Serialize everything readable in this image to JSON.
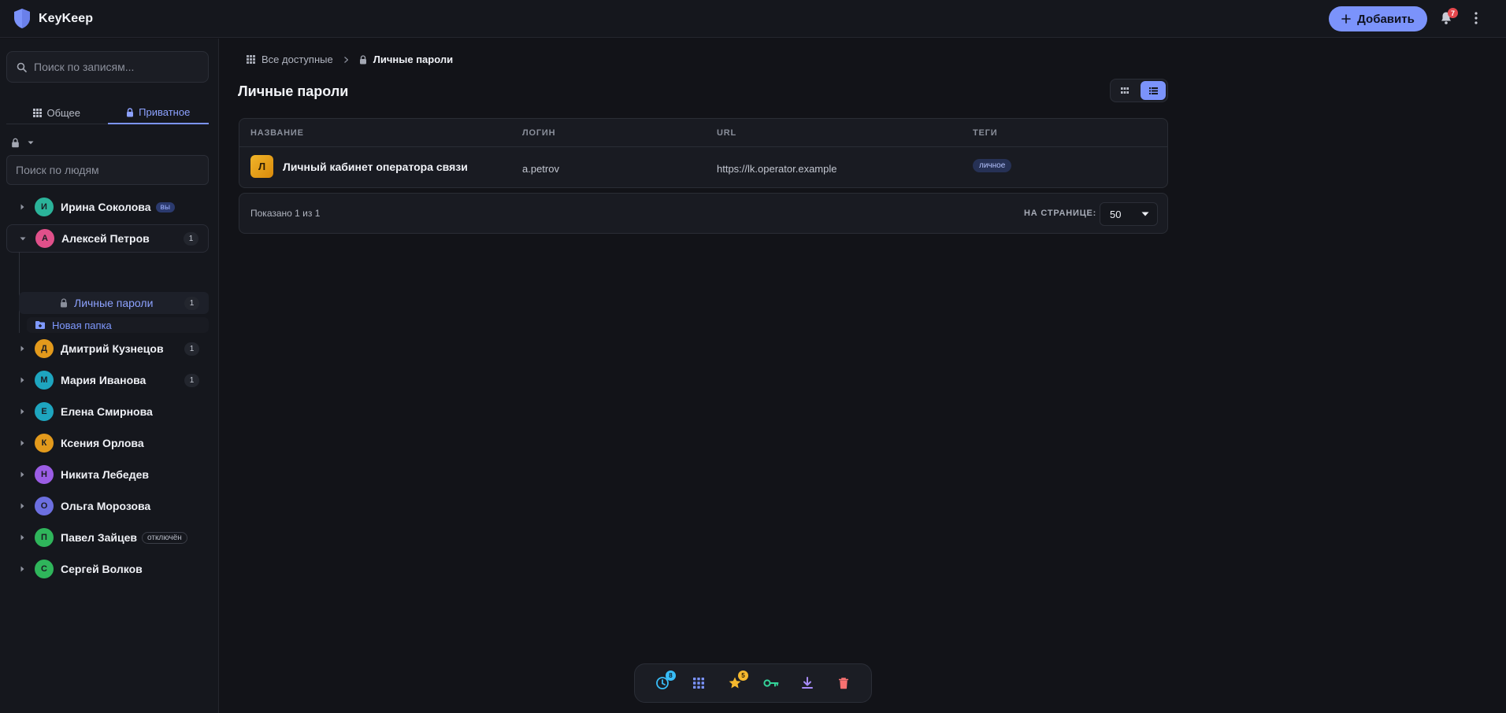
{
  "app": {
    "name": "KeyKeep",
    "add_label": "Добавить",
    "notifications_count": "7"
  },
  "sidebar": {
    "search_placeholder": "Поиск по записям...",
    "tabs": [
      {
        "label": "Общее",
        "icon": "grid-icon",
        "active": false
      },
      {
        "label": "Приватное",
        "icon": "lock-icon",
        "active": true
      }
    ],
    "people_search_placeholder": "Поиск по людям",
    "people": [
      {
        "initial": "И",
        "name": "Ирина Соколова",
        "badge": "вы",
        "count": "",
        "color": "#2bb39a"
      },
      {
        "initial": "А",
        "name": "Алексей Петров",
        "badge": "",
        "count": "1",
        "color": "#e0508a",
        "expanded": true
      },
      {
        "initial": "Д",
        "name": "Дмитрий Кузнецов",
        "badge": "",
        "count": "1",
        "color": "#e39a1c"
      },
      {
        "initial": "М",
        "name": "Мария Иванова",
        "badge": "",
        "count": "1",
        "color": "#1ea5bf"
      },
      {
        "initial": "Е",
        "name": "Елена Смирнова",
        "badge": "",
        "count": "",
        "color": "#1ea5bf"
      },
      {
        "initial": "К",
        "name": "Ксения Орлова",
        "badge": "",
        "count": "",
        "color": "#e39a1c"
      },
      {
        "initial": "Н",
        "name": "Никита Лебедев",
        "badge": "",
        "count": "",
        "color": "#9b5de5"
      },
      {
        "initial": "О",
        "name": "Ольга Морозова",
        "badge": "",
        "count": "",
        "color": "#6c6fe0"
      },
      {
        "initial": "П",
        "name": "Павел Зайцев",
        "badge": "отключён",
        "count": "",
        "color": "#2fb55b"
      },
      {
        "initial": "С",
        "name": "Сергей Волков",
        "badge": "",
        "count": "",
        "color": "#2fb55b"
      }
    ],
    "folder": {
      "label": "Личные пароли",
      "count": "1"
    },
    "new_folder_label": "Новая папка"
  },
  "main": {
    "breadcrumb": {
      "root": "Все доступные",
      "current": "Личные пароли"
    },
    "title": "Личные пароли",
    "view_mode": "list",
    "columns": [
      "НАЗВАНИЕ",
      "ЛОГИН",
      "URL",
      "ТЕГИ"
    ],
    "rows": [
      {
        "icon_letter": "Л",
        "title": "Личный кабинет оператора связи",
        "login": "a.petrov",
        "url": "https://lk.operator.example",
        "tag": "личное"
      }
    ],
    "pager": {
      "info": "Показано 1 из 1",
      "per_page_label": "НА СТРАНИЦЕ:",
      "per_page": "50"
    }
  },
  "dock": {
    "items": [
      {
        "icon": "clock-icon",
        "badge": "8",
        "color": "#38bdf8"
      },
      {
        "icon": "grid-icon",
        "badge": "",
        "color": "#7b93fb"
      },
      {
        "icon": "star-icon",
        "badge": "5",
        "color": "#f5b82e"
      },
      {
        "icon": "key-icon",
        "badge": "",
        "color": "#34d399"
      },
      {
        "icon": "download-icon",
        "badge": "",
        "color": "#a78bfa"
      },
      {
        "icon": "trash-icon",
        "badge": "",
        "color": "#f87171"
      }
    ]
  }
}
